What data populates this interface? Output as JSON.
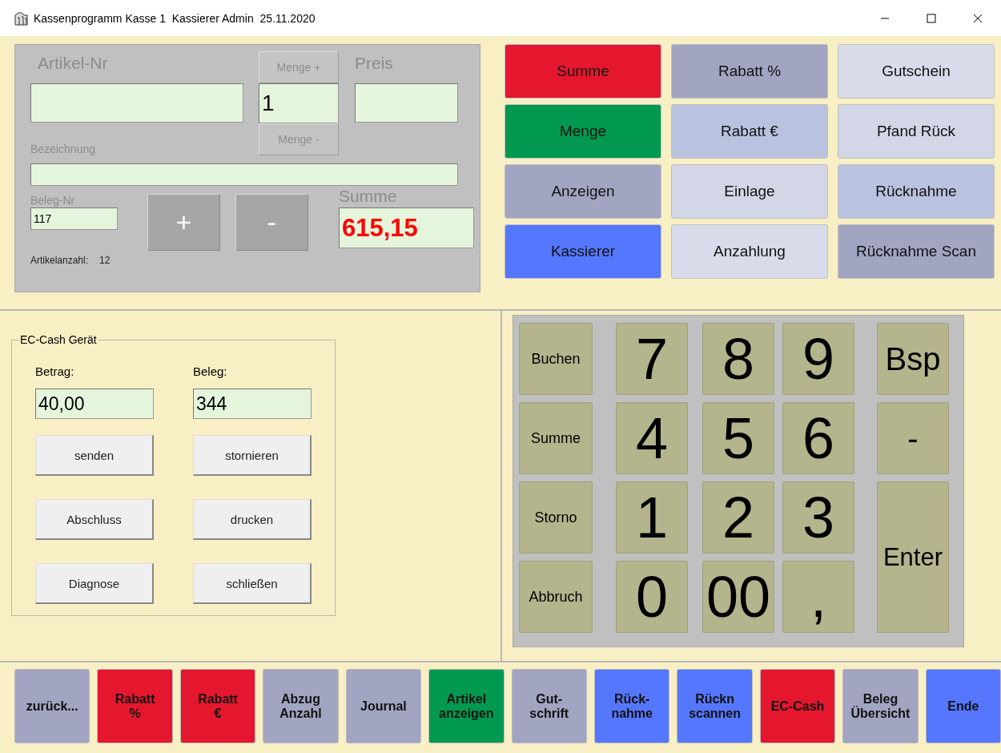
{
  "window": {
    "title": "Kassenprogramm Kasse 1  Kassierer Admin  25.11.2020"
  },
  "article_panel": {
    "article_label": "Artikel-Nr",
    "quantity_plus": "Menge +",
    "quantity_value": "1",
    "quantity_minus": "Menge -",
    "price_label": "Preis",
    "description_label": "Bezeichnung",
    "receipt_label": "Beleg-Nr",
    "receipt_value": "117",
    "plus": "+",
    "minus": "-",
    "total_label": "Summe",
    "total_value": "615,15",
    "item_count_label": "Artikelanzahl:",
    "item_count": "12"
  },
  "function_buttons": [
    {
      "label": "Summe",
      "color": "#e4172f"
    },
    {
      "label": "Rabatt %",
      "color": "#a1a5c1"
    },
    {
      "label": "Gutschein",
      "color": "#d8dbe9"
    },
    {
      "label": "Menge",
      "color": "#00994f"
    },
    {
      "label": "Rabatt €",
      "color": "#b9c2de"
    },
    {
      "label": "Pfand Rück",
      "color": "#d2d6e6"
    },
    {
      "label": "Anzeigen",
      "color": "#a1a5c1"
    },
    {
      "label": "Einlage",
      "color": "#d2d6e6"
    },
    {
      "label": "Rücknahme",
      "color": "#b9c2de"
    },
    {
      "label": "Kassierer",
      "color": "#5577fd"
    },
    {
      "label": "Anzahlung",
      "color": "#d8dbe9"
    },
    {
      "label": "Rücknahme Scan",
      "color": "#a1a5c1"
    }
  ],
  "ec_cash": {
    "title": "EC-Cash Gerät",
    "amount_label": "Betrag:",
    "amount_value": "40,00",
    "receipt_label": "Beleg:",
    "receipt_value": "344",
    "buttons": [
      "senden",
      "stornieren",
      "Abschluss",
      "drucken",
      "Diagnose",
      "schließen"
    ]
  },
  "keypad": [
    {
      "label": "Buchen",
      "kind": "text"
    },
    {
      "label": "7",
      "kind": "digit"
    },
    {
      "label": "8",
      "kind": "digit"
    },
    {
      "label": "9",
      "kind": "digit"
    },
    {
      "label": "Bsp",
      "kind": "large"
    },
    {
      "label": "Summe",
      "kind": "text"
    },
    {
      "label": "4",
      "kind": "digit"
    },
    {
      "label": "5",
      "kind": "digit"
    },
    {
      "label": "6",
      "kind": "digit"
    },
    {
      "label": "-",
      "kind": "large"
    },
    {
      "label": "Storno",
      "kind": "text"
    },
    {
      "label": "1",
      "kind": "digit"
    },
    {
      "label": "2",
      "kind": "digit"
    },
    {
      "label": "3",
      "kind": "digit"
    },
    {
      "label": "Enter",
      "kind": "tall"
    },
    {
      "label": "Abbruch",
      "kind": "text"
    },
    {
      "label": "0",
      "kind": "digit"
    },
    {
      "label": "00",
      "kind": "digit"
    },
    {
      "label": ",",
      "kind": "digit"
    }
  ],
  "bottom_buttons": [
    {
      "label": "zurück...",
      "color": "#a1a5c1"
    },
    {
      "label": "Rabatt\n%",
      "color": "#e4172f"
    },
    {
      "label": "Rabatt\n€",
      "color": "#e4172f"
    },
    {
      "label": "Abzug\nAnzahl",
      "color": "#a1a5c1"
    },
    {
      "label": "Journal",
      "color": "#a1a5c1"
    },
    {
      "label": "Artikel\nanzeigen",
      "color": "#00994f"
    },
    {
      "label": "Gut-\nschrift",
      "color": "#a1a5c1"
    },
    {
      "label": "Rück-\nnahme",
      "color": "#5577fd"
    },
    {
      "label": "Rückn\nscannen",
      "color": "#5577fd"
    },
    {
      "label": "EC-Cash",
      "color": "#e4172f"
    },
    {
      "label": "Beleg\nÜbersicht",
      "color": "#a1a5c1"
    },
    {
      "label": "Ende",
      "color": "#5577fd"
    }
  ]
}
